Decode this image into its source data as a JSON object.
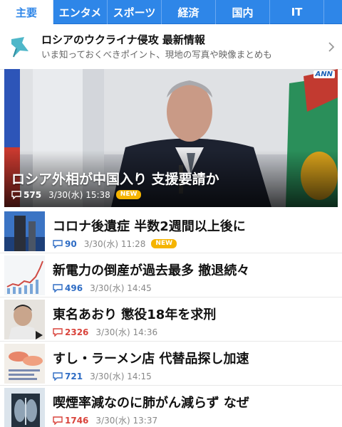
{
  "tabs": [
    {
      "label": "主要",
      "active": true
    },
    {
      "label": "エンタメ",
      "active": false
    },
    {
      "label": "スポーツ",
      "active": false
    },
    {
      "label": "経済",
      "active": false
    },
    {
      "label": "国内",
      "active": false
    },
    {
      "label": "IT",
      "active": false
    }
  ],
  "banner": {
    "title": "ロシアのウクライナ侵攻 最新情報",
    "subtitle": "いま知っておくべきポイント、現地の写真や映像まとめも",
    "icon": "pin-icon"
  },
  "hero": {
    "title": "ロシア外相が中国入り 支援要請か",
    "comments": "575",
    "date": "3/30(水) 15:38",
    "badge": "NEW",
    "watermark": "ANN"
  },
  "articles": [
    {
      "title": "コロナ後遺症 半数2週間以上後に",
      "comments": "90",
      "date": "3/30(水) 11:28",
      "badge": "NEW",
      "comment_color": "blue"
    },
    {
      "title": "新電力の倒産が過去最多 撤退続々",
      "comments": "496",
      "date": "3/30(水) 14:45",
      "comment_color": "blue"
    },
    {
      "title": "東名あおり 懲役18年を求刑",
      "comments": "2326",
      "date": "3/30(水) 14:36",
      "comment_color": "red"
    },
    {
      "title": "すし・ラーメン店 代替品探し加速",
      "comments": "721",
      "date": "3/30(水) 14:15",
      "comment_color": "blue"
    },
    {
      "title": "喫煙率減なのに肺がん減らず なぜ",
      "comments": "1746",
      "date": "3/30(水) 13:37",
      "comment_color": "red"
    }
  ],
  "colors": {
    "accent": "#2e86e8",
    "new_badge": "#f5b400",
    "comment_blue": "#2e6cc4",
    "comment_red": "#d9433b"
  }
}
